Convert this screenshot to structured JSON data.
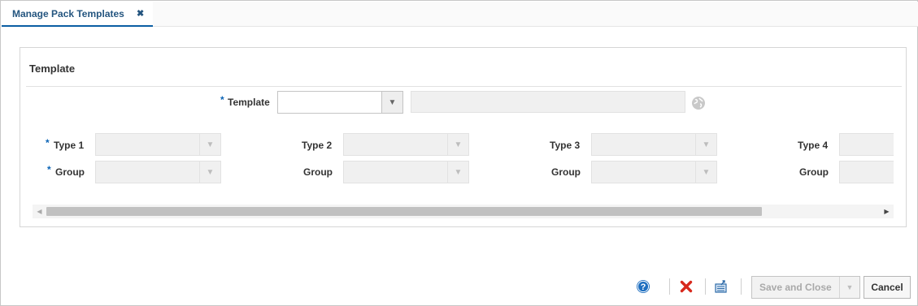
{
  "tab": {
    "label": "Manage Pack Templates",
    "close_glyph": "✖"
  },
  "panel": {
    "title": "Template",
    "template_label": "Template",
    "required_marker": "*",
    "template_value": "",
    "template_description": ""
  },
  "grid": {
    "columns": [
      {
        "type_label": "Type 1",
        "group_label": "Group",
        "required": true
      },
      {
        "type_label": "Type 2",
        "group_label": "Group",
        "required": false
      },
      {
        "type_label": "Type 3",
        "group_label": "Group",
        "required": false
      },
      {
        "type_label": "Type 4",
        "group_label": "Group",
        "required": false
      }
    ]
  },
  "footer": {
    "help_icon": "help-icon",
    "delete_icon": "delete-icon",
    "export_icon": "export-icon",
    "save_close_label": "Save and Close",
    "cancel_label": "Cancel"
  },
  "colors": {
    "accent": "#0b5ea3",
    "required": "#0b64b6",
    "delete": "#d7281c"
  }
}
